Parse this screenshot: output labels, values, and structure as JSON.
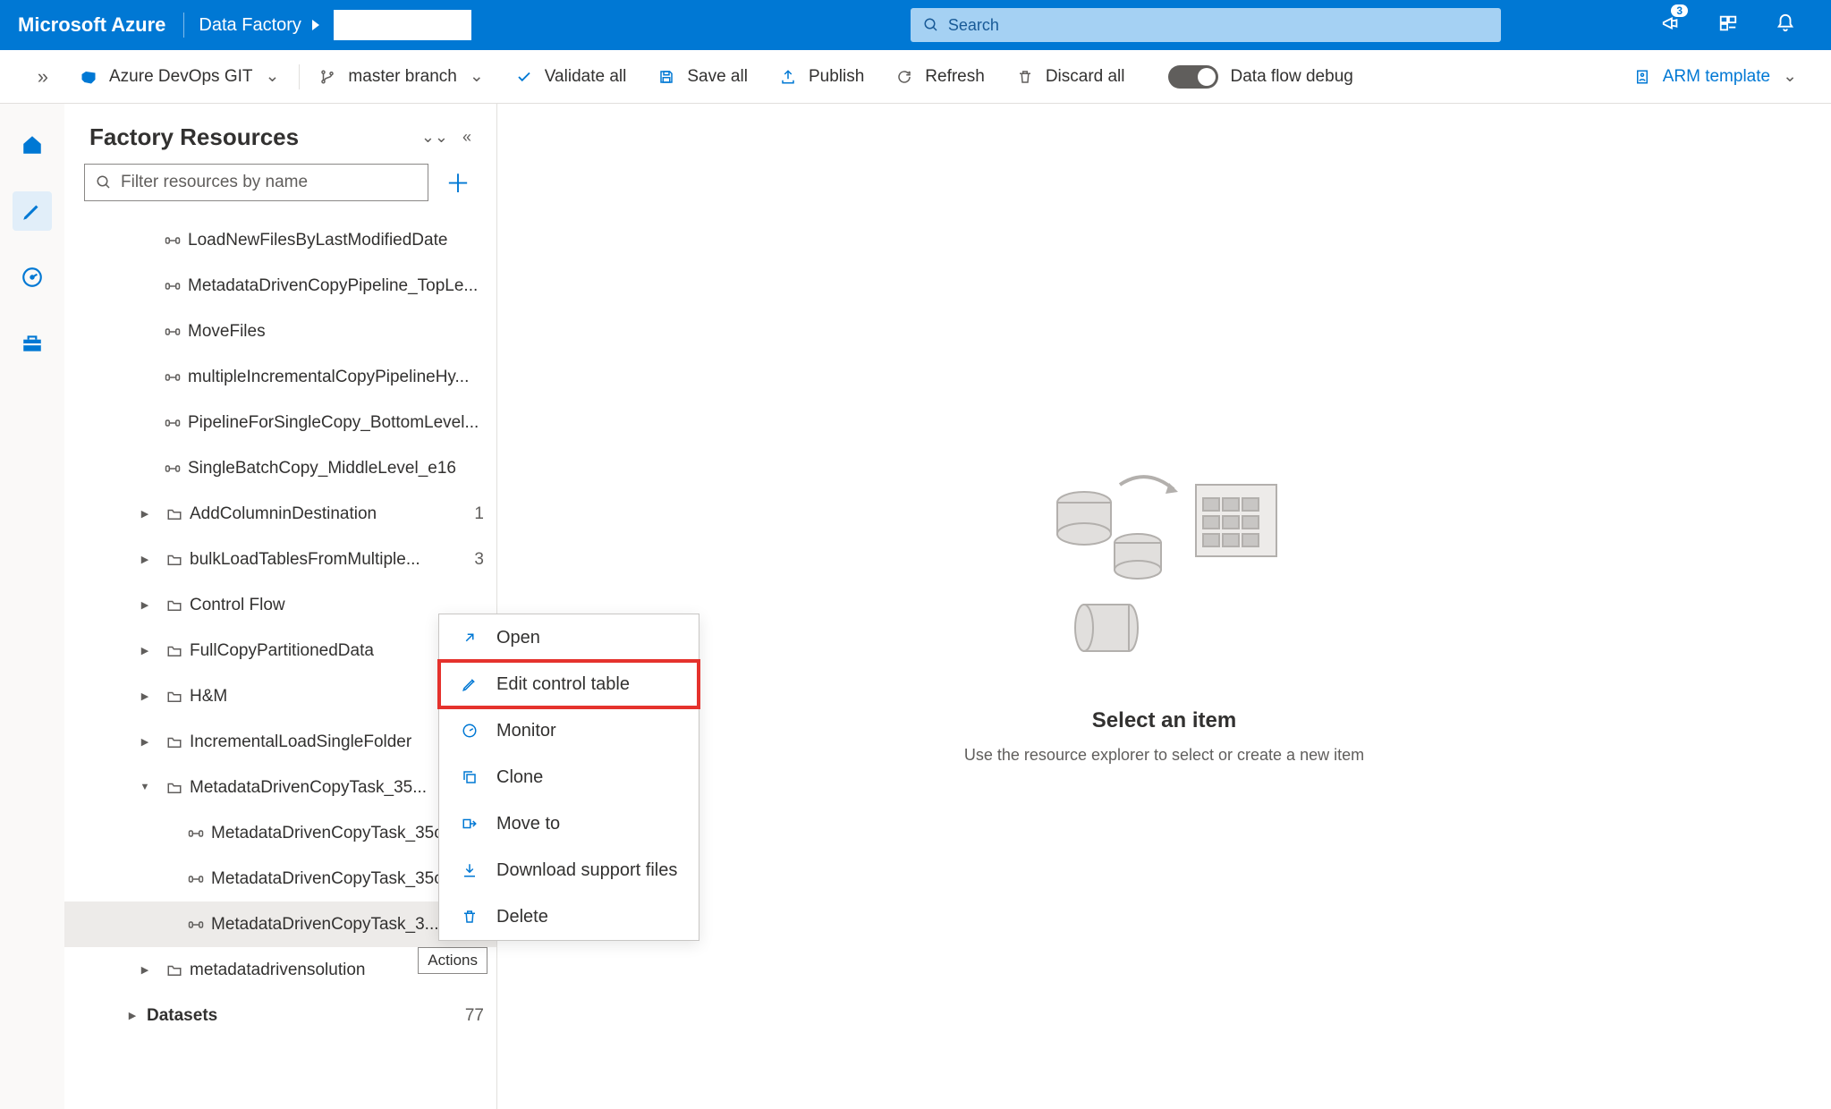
{
  "topbar": {
    "brand": "Microsoft Azure",
    "service": "Data Factory",
    "search_placeholder": "Search",
    "notification_count": "3"
  },
  "toolbar": {
    "git_label": "Azure DevOps GIT",
    "branch_label": "master branch",
    "validate": "Validate all",
    "save": "Save all",
    "publish": "Publish",
    "refresh": "Refresh",
    "discard": "Discard all",
    "debug_label": "Data flow debug",
    "arm": "ARM template"
  },
  "sidepanel": {
    "title": "Factory Resources",
    "filter_placeholder": "Filter resources by name"
  },
  "tree": {
    "pipelines": [
      "LoadNewFilesByLastModifiedDate",
      "MetadataDrivenCopyPipeline_TopLe...",
      "MoveFiles",
      "multipleIncrementalCopyPipelineHy...",
      "PipelineForSingleCopy_BottomLevel...",
      "SingleBatchCopy_MiddleLevel_e16"
    ],
    "folders": [
      {
        "label": "AddColumninDestination",
        "count": "1"
      },
      {
        "label": "bulkLoadTablesFromMultiple...",
        "count": "3"
      },
      {
        "label": "Control Flow"
      },
      {
        "label": "FullCopyPartitionedData"
      },
      {
        "label": "H&M"
      },
      {
        "label": "IncrementalLoadSingleFolder"
      },
      {
        "label": "MetadataDrivenCopyTask_35...",
        "open": true,
        "children": [
          "MetadataDrivenCopyTask_35c",
          "MetadataDrivenCopyTask_35c",
          "MetadataDrivenCopyTask_3..."
        ]
      },
      {
        "label": "metadatadrivensolution"
      }
    ],
    "datasets_label": "Datasets",
    "datasets_count": "77",
    "actions_tooltip": "Actions"
  },
  "canvas": {
    "title": "Select an item",
    "subtitle": "Use the resource explorer to select or create a new item"
  },
  "context_menu": {
    "open": "Open",
    "edit": "Edit control table",
    "monitor": "Monitor",
    "clone": "Clone",
    "move": "Move to",
    "download": "Download support files",
    "delete": "Delete"
  }
}
